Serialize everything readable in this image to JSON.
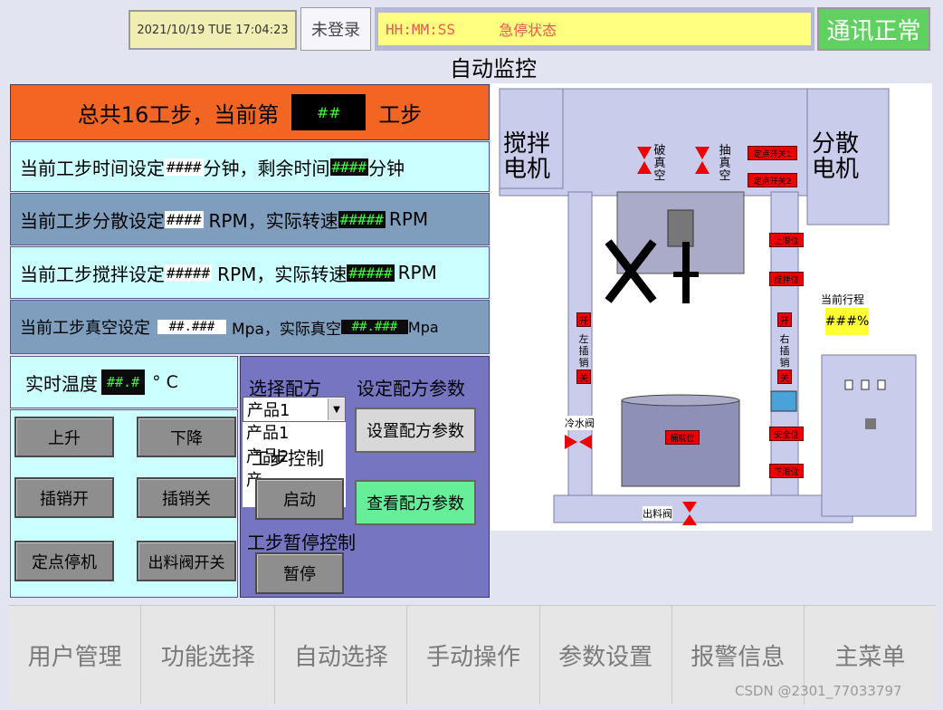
{
  "header": {
    "datetime": "2021/10/19 TUE 17:04:23",
    "login_status": "未登录",
    "alarm_time": "HH:MM:SS",
    "alarm_text": "急停状态",
    "comm_status": "通讯正常"
  },
  "page_title": "自动监控",
  "step_banner": {
    "prefix": "总共16工步，当前第",
    "value": "##",
    "suffix": "工步"
  },
  "rows": [
    {
      "label": "当前工步时间设定",
      "set": "####",
      "mid": "分钟，剩余时间",
      "actual": "####",
      "unit": "分钟"
    },
    {
      "label": "当前工步分散设定",
      "set": "####",
      "mid": "RPM，实际转速",
      "actual": "#####",
      "unit": "RPM"
    },
    {
      "label": "当前工步搅拌设定",
      "set": "#####",
      "mid": "RPM，实际转速",
      "actual": "#####",
      "unit": "RPM"
    },
    {
      "label": "当前工步真空设定",
      "set": "##.###",
      "mid": "Mpa，实际真空",
      "actual": "##.###",
      "unit": "Mpa"
    }
  ],
  "temperature": {
    "label": "实时温度",
    "value": "##.#",
    "unit": "° C"
  },
  "buttons": {
    "up": "上升",
    "down": "下降",
    "pin_open": "插销开",
    "pin_close": "插销关",
    "fixed_stop": "定点停机",
    "discharge_valve": "出料阀开关"
  },
  "recipe": {
    "select_label": "选择配方",
    "selected": "产品1",
    "options": [
      "产品1",
      "产品2",
      "产"
    ],
    "set_params_label": "设定配方参数",
    "set_params_button": "设置配方参数",
    "view_params_button": "查看配方参数",
    "step_control_label": "工步控制",
    "start_button": "启动",
    "pause_control_label": "工步暂停控制",
    "pause_button": "暂停"
  },
  "diagram": {
    "mixer_motor": "搅拌\n电机",
    "disperse_motor": "分散\n电机",
    "break_vacuum": "破\n真\n空",
    "pump_vacuum": "抽\n真\n空",
    "point_switch1": "定点开关1",
    "point_switch2": "定点开关2",
    "upper_limit": "上限位",
    "stir_limit": "搅拌位",
    "lower_limit": "下限位",
    "safe_limit": "安全位",
    "open_tag": "开",
    "close_tag": "关",
    "left_pin": "左\n插\n销",
    "right_pin": "右\n插\n销",
    "cooling_valve": "冷水阀",
    "discharge_valve": "出料阀",
    "tank_tag": "桶就位",
    "travel_label": "当前行程",
    "travel_value": "###%"
  },
  "nav": [
    "用户管理",
    "功能选择",
    "自动选择",
    "手动操作",
    "参数设置",
    "报警信息",
    "主菜单"
  ],
  "watermark": "CSDN @2301_77033797",
  "colors": {
    "banner": "#f26522",
    "row_light": "#ccffff",
    "row_dark": "#7f9ebd",
    "recipe_panel": "#7575c2",
    "comm_ok": "#60d060",
    "alarm_bar": "#ffff80",
    "green_button": "#66ee99"
  }
}
